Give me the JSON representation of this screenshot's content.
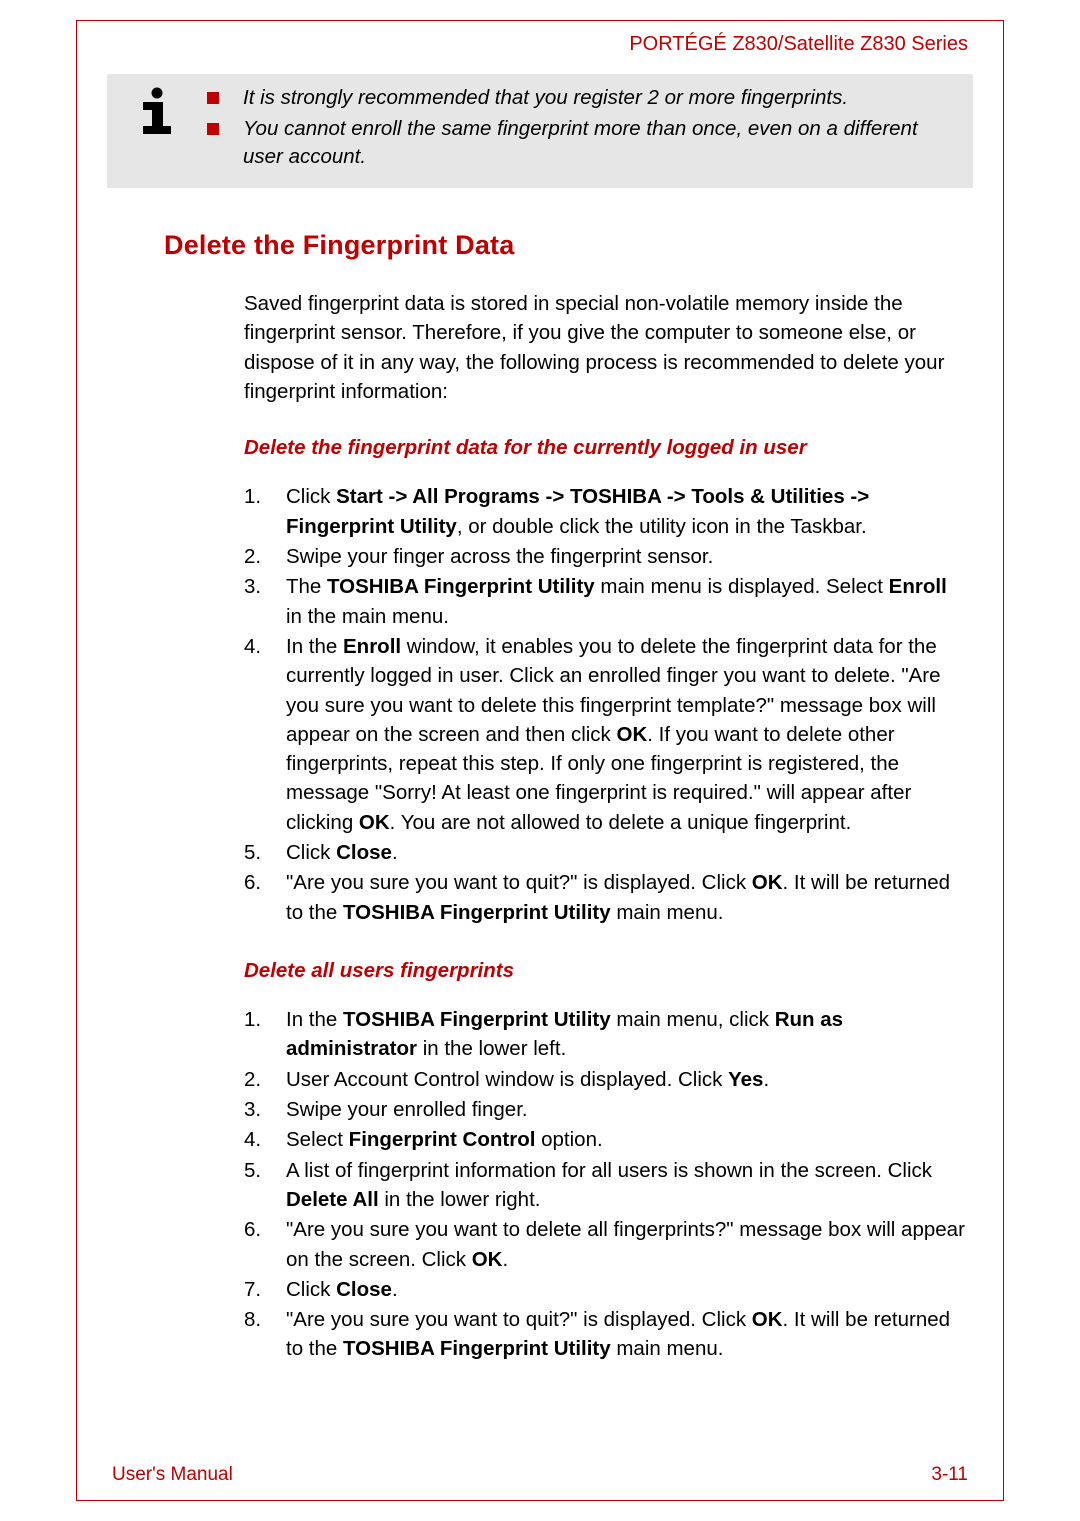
{
  "header": "PORTÉGÉ Z830/Satellite Z830 Series",
  "info_box": {
    "bullets": [
      "It is strongly recommended that you register 2 or more fingerprints.",
      "You cannot enroll the same fingerprint more than once, even on a different user account."
    ]
  },
  "section_heading": "Delete the Fingerprint Data",
  "intro_paragraph": "Saved fingerprint data is stored in special non-volatile memory inside the fingerprint sensor. Therefore, if you give the computer to someone else, or dispose of it in any way, the following process is recommended to delete your fingerprint information:",
  "subsection1": {
    "heading": "Delete the fingerprint data for the currently logged in user",
    "steps": [
      {
        "pre": "Click ",
        "b1": "Start -> All Programs -> TOSHIBA -> Tools & Utilities -> Fingerprint Utility",
        "mid": ", or double click the utility icon in the Taskbar."
      },
      {
        "text": "Swipe your finger across the fingerprint sensor."
      },
      {
        "pre": "The ",
        "b1": "TOSHIBA Fingerprint Utility",
        "mid": " main menu is displayed. Select ",
        "b2": "Enroll",
        "post": " in the main menu."
      },
      {
        "pre": "In the ",
        "b1": "Enroll",
        "mid": " window, it enables you to delete the fingerprint data for the currently logged in user. Click an enrolled finger you want to delete. \"Are you sure you want to delete this fingerprint template?\" message box will appear on the screen and then click ",
        "b2": "OK",
        "mid2": ". If you want to delete other fingerprints, repeat this step. If only one fingerprint is registered, the message \"Sorry! At least one fingerprint is required.\" will appear after clicking ",
        "b3": "OK",
        "post": ". You are not allowed to delete a unique fingerprint."
      },
      {
        "pre": "Click ",
        "b1": "Close",
        "post": "."
      },
      {
        "pre": "\"Are you sure you want to quit?\" is displayed. Click ",
        "b1": "OK",
        "mid": ". It will be returned to the ",
        "b2": "TOSHIBA Fingerprint Utility",
        "post": " main menu."
      }
    ]
  },
  "subsection2": {
    "heading": "Delete all users fingerprints",
    "steps": [
      {
        "pre": "In the ",
        "b1": "TOSHIBA Fingerprint Utility",
        "mid": " main menu, click ",
        "b2": "Run as administrator",
        "post": " in the lower left."
      },
      {
        "pre": "User Account Control window is displayed. Click ",
        "b1": "Yes",
        "post": "."
      },
      {
        "text": "Swipe your enrolled finger."
      },
      {
        "pre": "Select ",
        "b1": "Fingerprint Control",
        "post": " option."
      },
      {
        "pre": "A list of fingerprint information for all users is shown in the screen. Click ",
        "b1": "Delete All",
        "post": " in the lower right."
      },
      {
        "pre": "\"Are you sure you want to delete all fingerprints?\" message box will appear on the screen. Click ",
        "b1": "OK",
        "post": "."
      },
      {
        "pre": "Click ",
        "b1": "Close",
        "post": "."
      },
      {
        "pre": "\"Are you sure you want to quit?\" is displayed. Click ",
        "b1": "OK",
        "mid": ". It will be returned to the ",
        "b2": "TOSHIBA Fingerprint Utility",
        "post": " main menu."
      }
    ]
  },
  "footer": {
    "left": "User's Manual",
    "right": "3-11"
  }
}
